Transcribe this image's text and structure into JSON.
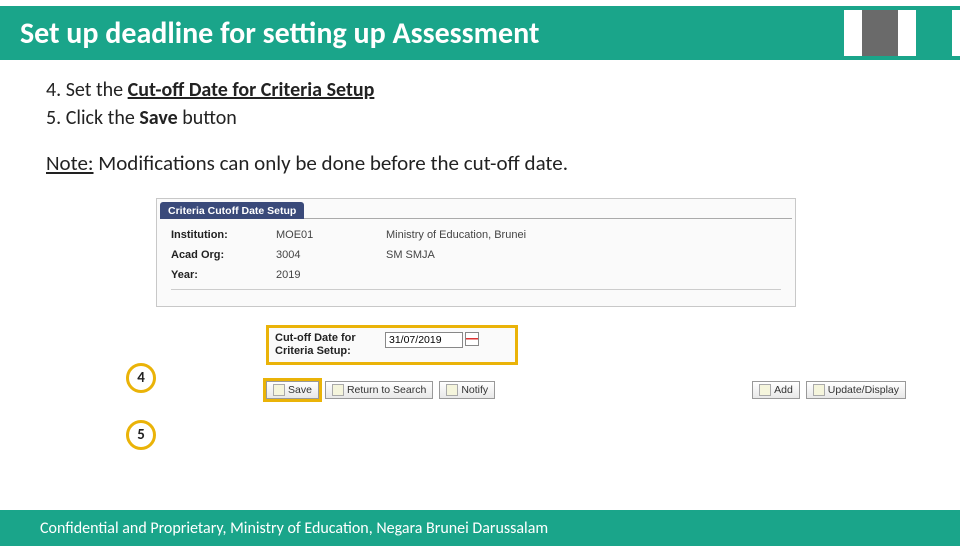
{
  "title": "Set up deadline for setting up Assessment",
  "steps": {
    "s4_prefix": "4. Set the ",
    "s4_bold": "Cut-off Date for Criteria Setup",
    "s5_prefix": "5. Click the ",
    "s5_bold": "Save",
    "s5_suffix": " button"
  },
  "note": {
    "label": "Note:",
    "text": " Modifications can only be done before the cut-off date."
  },
  "panel": {
    "tab": "Criteria Cutoff Date Setup",
    "institution_lbl": "Institution:",
    "institution_code": "MOE01",
    "institution_name": "Ministry of Education, Brunei",
    "acadorg_lbl": "Acad Org:",
    "acadorg_code": "3004",
    "acadorg_name": "SM SMJA",
    "year_lbl": "Year:",
    "year_val": "2019"
  },
  "cutoff": {
    "label": "Cut-off Date for Criteria Setup:",
    "value": "31/07/2019"
  },
  "toolbar": {
    "save": "Save",
    "return": "Return to Search",
    "notify": "Notify",
    "add": "Add",
    "update": "Update/Display"
  },
  "markers": {
    "m4": "4",
    "m5": "5"
  },
  "footer": "Confidential and Proprietary, Ministry of Education, Negara Brunei Darussalam"
}
